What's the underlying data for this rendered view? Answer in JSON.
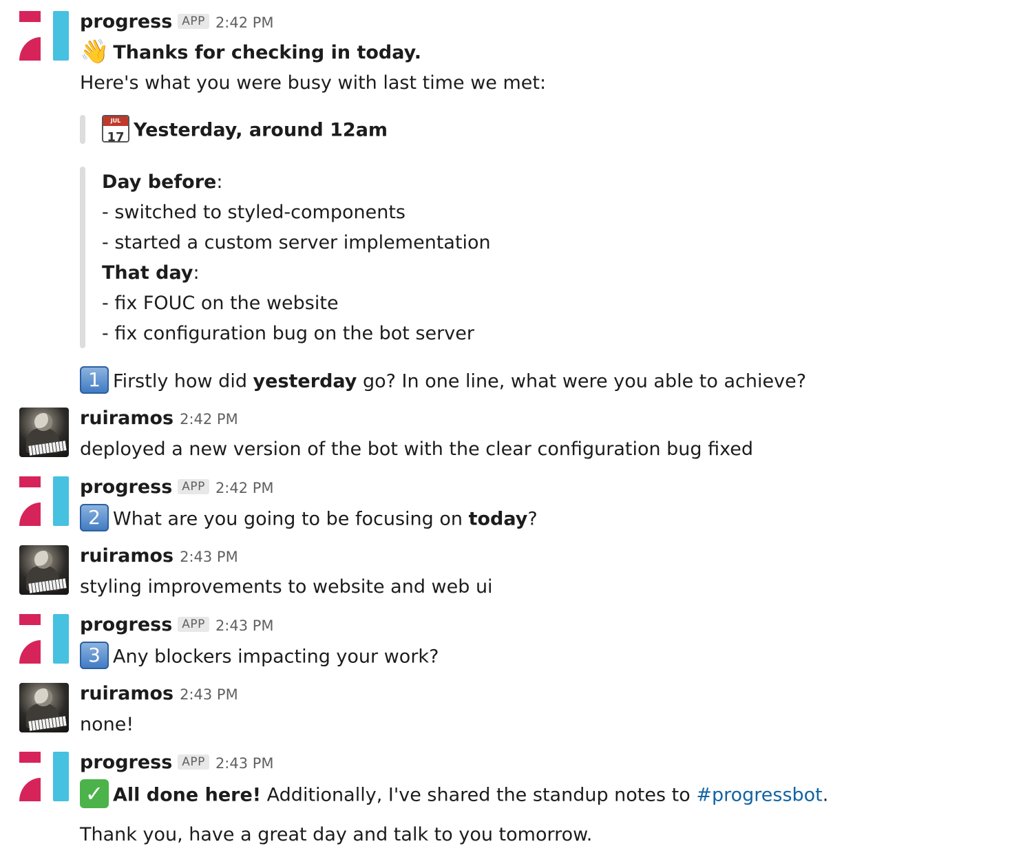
{
  "messages": [
    {
      "author": "progress",
      "badge": "APP",
      "time": "2:42 PM",
      "intro_title": "Thanks for checking in today.",
      "intro_text": "Here's what you were busy with last time we met:",
      "quote_heading": "Yesterday, around 12am",
      "calendar_month": "JUL",
      "calendar_day": "17",
      "day_before_label": "Day before",
      "day_before_items": [
        "- switched to styled-components",
        "- started a custom server implementation"
      ],
      "that_day_label": "That day",
      "that_day_items": [
        "- fix FOUC on the website",
        "- fix configuration bug on the bot server"
      ],
      "question_number": "1",
      "question_pre": "Firstly how did ",
      "question_bold": "yesterday",
      "question_post": " go? In one line, what were you able to achieve?"
    },
    {
      "author": "ruiramos",
      "time": "2:42 PM",
      "text": "deployed a new version of the bot with the clear configuration bug fixed"
    },
    {
      "author": "progress",
      "badge": "APP",
      "time": "2:42 PM",
      "question_number": "2",
      "question_pre": "What are you going to be focusing on ",
      "question_bold": "today",
      "question_post": "?"
    },
    {
      "author": "ruiramos",
      "time": "2:43 PM",
      "text": "styling improvements to website and web ui"
    },
    {
      "author": "progress",
      "badge": "APP",
      "time": "2:43 PM",
      "question_number": "3",
      "question_text": "Any blockers impacting your work?"
    },
    {
      "author": "ruiramos",
      "time": "2:43 PM",
      "text": "none!"
    },
    {
      "author": "progress",
      "badge": "APP",
      "time": "2:43 PM",
      "done_bold": "All done here!",
      "done_text": " Additionally, I've shared the standup notes to ",
      "channel_link": "#progressbot",
      "done_end": ".",
      "closing": "Thank you, have a great day and talk to you tomorrow."
    }
  ],
  "colors": {
    "logo_red": "#d6245b",
    "logo_blue": "#46c1e0",
    "link": "#1264a3",
    "quote_bar": "#dddddd"
  },
  "icons": [
    "wave-emoji-icon",
    "calendar-icon",
    "keycap-one-icon",
    "keycap-two-icon",
    "keycap-three-icon",
    "check-mark-icon"
  ]
}
